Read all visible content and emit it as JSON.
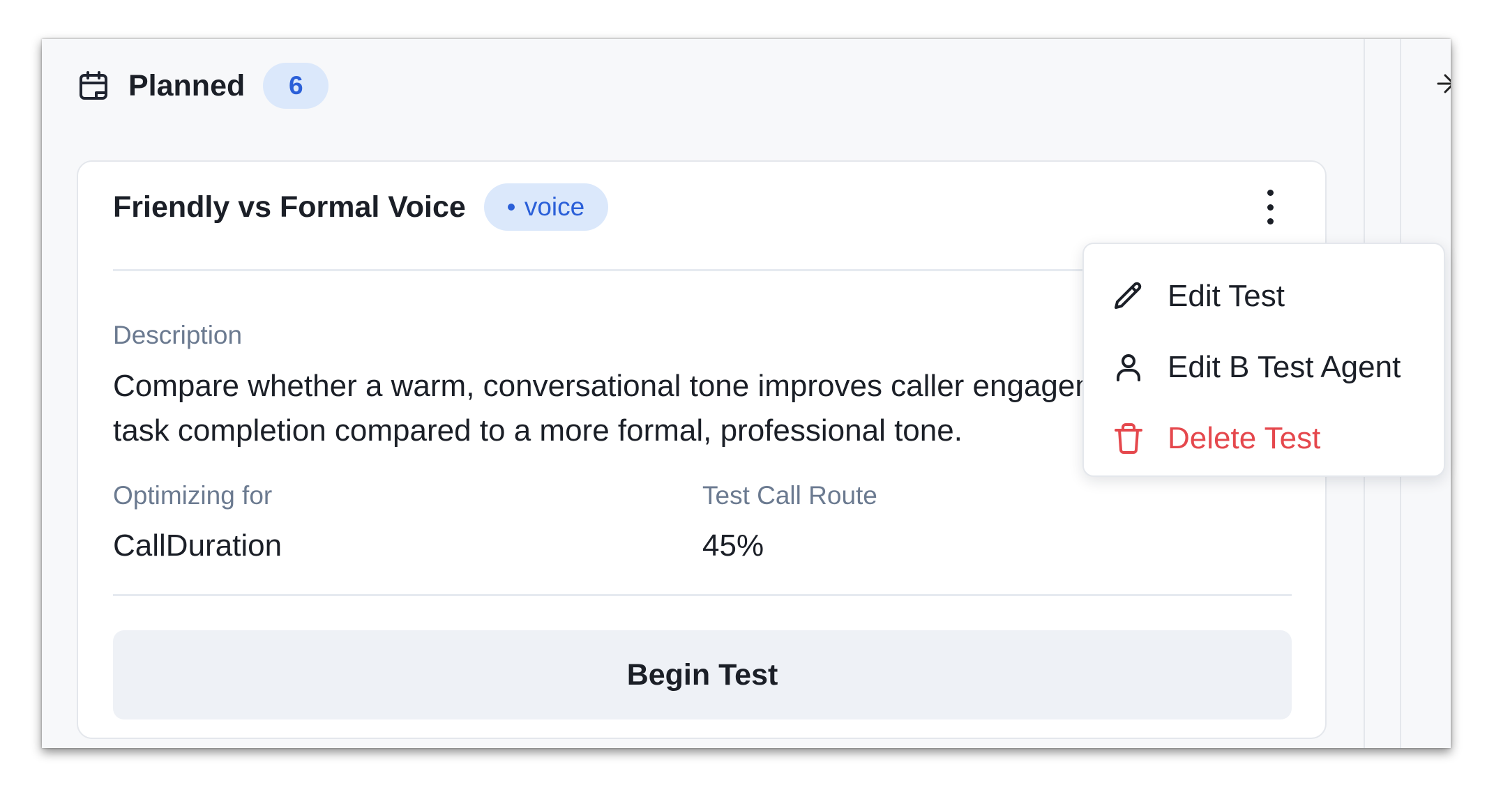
{
  "column": {
    "title": "Planned",
    "count": "6",
    "icon": "calendar-icon"
  },
  "card": {
    "title": "Friendly vs Formal Voice",
    "tag": "voice",
    "description_label": "Description",
    "description": "Compare whether a warm, conversational tone improves caller engagement and task completion compared to a more formal, professional tone.",
    "optimizing_label": "Optimizing for",
    "optimizing_value": "CallDuration",
    "route_label": "Test Call Route",
    "route_value": "45%",
    "begin_button": "Begin Test"
  },
  "menu": {
    "items": [
      {
        "label": "Edit Test",
        "icon": "pencil-icon"
      },
      {
        "label": "Edit B Test Agent",
        "icon": "user-icon"
      },
      {
        "label": "Delete Test",
        "icon": "trash-icon",
        "color": "#e5484d"
      }
    ]
  },
  "colors": {
    "accent": "#2a5fd8",
    "badge_bg": "#dbe8fb",
    "danger": "#e5484d"
  }
}
